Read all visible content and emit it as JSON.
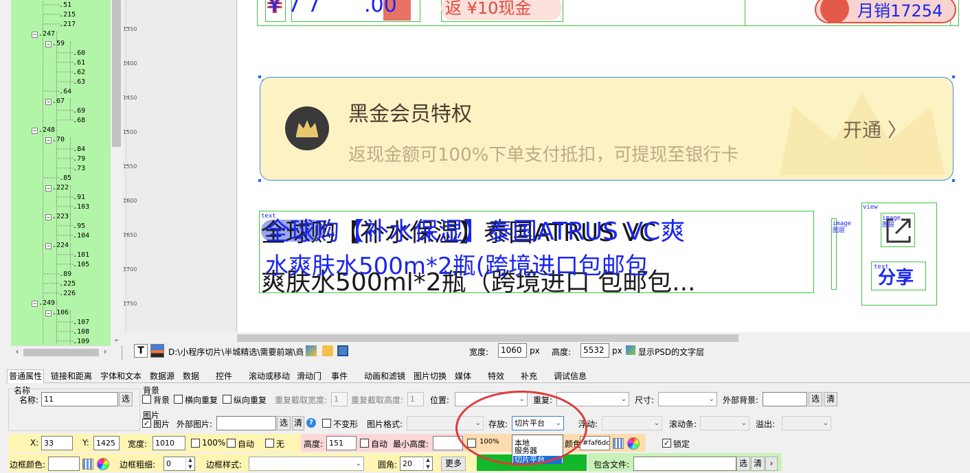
{
  "colors": {
    "tree_bg": "#b3f5a8",
    "vip_bg": "#fdf2c3",
    "blue_overlay": "#1a26f0",
    "green_outline": "#3dc23d",
    "annotation_red": "#e03a3a"
  },
  "tree": {
    "nodes": [
      {
        "label": ".51",
        "toggle": ""
      },
      {
        "label": ".215",
        "toggle": ""
      },
      {
        "label": ".217",
        "toggle": ""
      },
      {
        "label": ".247",
        "toggle": "−"
      },
      {
        "label": ".59",
        "toggle": "−"
      },
      {
        "label": ".60",
        "toggle": ""
      },
      {
        "label": ".61",
        "toggle": ""
      },
      {
        "label": ".62",
        "toggle": ""
      },
      {
        "label": ".63",
        "toggle": ""
      },
      {
        "label": ".64",
        "toggle": ""
      },
      {
        "label": ".67",
        "toggle": "−"
      },
      {
        "label": ".69",
        "toggle": ""
      },
      {
        "label": ".68",
        "toggle": ""
      },
      {
        "label": ".248",
        "toggle": "−"
      },
      {
        "label": ".70",
        "toggle": "−"
      },
      {
        "label": ".84",
        "toggle": ""
      },
      {
        "label": ".79",
        "toggle": ""
      },
      {
        "label": ".73",
        "toggle": ""
      },
      {
        "label": ".85",
        "toggle": ""
      },
      {
        "label": ".222",
        "toggle": "−"
      },
      {
        "label": ".91",
        "toggle": ""
      },
      {
        "label": ".103",
        "toggle": ""
      },
      {
        "label": ".223",
        "toggle": "−"
      },
      {
        "label": ".95",
        "toggle": ""
      },
      {
        "label": ".104",
        "toggle": ""
      },
      {
        "label": ".224",
        "toggle": "−"
      },
      {
        "label": ".101",
        "toggle": ""
      },
      {
        "label": ".105",
        "toggle": ""
      },
      {
        "label": ".89",
        "toggle": ""
      },
      {
        "label": ".225",
        "toggle": ""
      },
      {
        "label": ".226",
        "toggle": ""
      },
      {
        "label": ".249",
        "toggle": "−"
      },
      {
        "label": ".106",
        "toggle": "−"
      },
      {
        "label": ".107",
        "toggle": ""
      },
      {
        "label": ".108",
        "toggle": ""
      },
      {
        "label": ".109",
        "toggle": ""
      }
    ]
  },
  "ruler": {
    "ticks": [
      "1350",
      "1400",
      "1450",
      "1500",
      "1550",
      "1600",
      "1650",
      "1700",
      "1750"
    ]
  },
  "canvas": {
    "price_big": "¥ 7 7",
    "price_cents": ".00",
    "cashback": "返 ¥10现金",
    "sales": "月销17254",
    "tag_text": "text",
    "tag_image": "image",
    "tag_image_cn": "图层",
    "tag_view": "view",
    "vip_title": "黑金会员特权",
    "vip_desc": "返现金额可100%下单支付抵扣，可提现至银行卡",
    "vip_open": "开通 〉",
    "product_black_line1": "全球购【补水保湿】泰国ATRUS VC",
    "product_black_line2": "爽肤水500ml*2瓶（跨境进口 包邮包...",
    "product_blue_line1": "全球购【补水保湿】泰国ATRUS VC爽",
    "product_blue_line2": "水爽肤水500m*2瓶(跨境进口包邮包",
    "share": "分享"
  },
  "pathbar": {
    "path": "D:\\小程序切片\\半城精选\\需要前端\\商",
    "width_label": "宽度:",
    "width_value": "1060",
    "width_unit": "px",
    "height_label": "高度:",
    "height_value": "5532",
    "height_unit": "px",
    "show_psd": "显示PSD的文字层"
  },
  "tabs": [
    "普通属性",
    "链接和距离",
    "字体和文本",
    "数据源",
    "数据",
    "控件",
    "滚动或移动",
    "滑动门",
    "事件",
    "动画和滤镜",
    "图片切换",
    "媒体",
    "特效",
    "补充",
    "调试信息"
  ],
  "props": {
    "name_group": "名称",
    "name_label": "名称:",
    "name_value": "11",
    "select_btn": "选",
    "clear_btn": "清",
    "bg_group": "背景",
    "bg_chk": "背景",
    "bg_hrepeat": "横向重复",
    "bg_vrepeat": "纵向重复",
    "repeat_w": "重复截取宽度:",
    "repeat_w_val": "1",
    "repeat_h": "重复截取高度:",
    "repeat_h_val": "1",
    "position": "位置:",
    "repeat": "重复:",
    "size": "尺寸:",
    "ext_bg": "外部背景:",
    "img_group": "图片",
    "img_chk": "图片",
    "ext_img": "外部图片:",
    "no_deform": "不变形",
    "img_format": "图片格式:",
    "storage": "存放:",
    "storage_value": "切片平台",
    "float": "浮动:",
    "scrollbar": "滚动条:",
    "overflow": "溢出:",
    "x_label": "X:",
    "x_value": "33",
    "y_label": "Y:",
    "y_value": "1425",
    "w_label": "宽度:",
    "w_value": "1010",
    "pct100": "100%",
    "auto": "自动",
    "none": "无",
    "h_label": "高度:",
    "h_value": "151",
    "h_auto": "自动",
    "min_h": "最小高度:",
    "h_pct": "100%",
    "color_label": "颜色:",
    "color_value": "#faf6dc",
    "lock": "锁定",
    "border_color": "边框颜色:",
    "border_width": "边框粗细:",
    "border_width_val": "0",
    "border_style": "边框样式:",
    "radius": "圆角:",
    "radius_val": "20",
    "more": "更多",
    "include_file": "包含文件:"
  },
  "dropdown": {
    "options": [
      "本地",
      "服务器",
      "切片平台"
    ],
    "selected": "切片平台"
  }
}
